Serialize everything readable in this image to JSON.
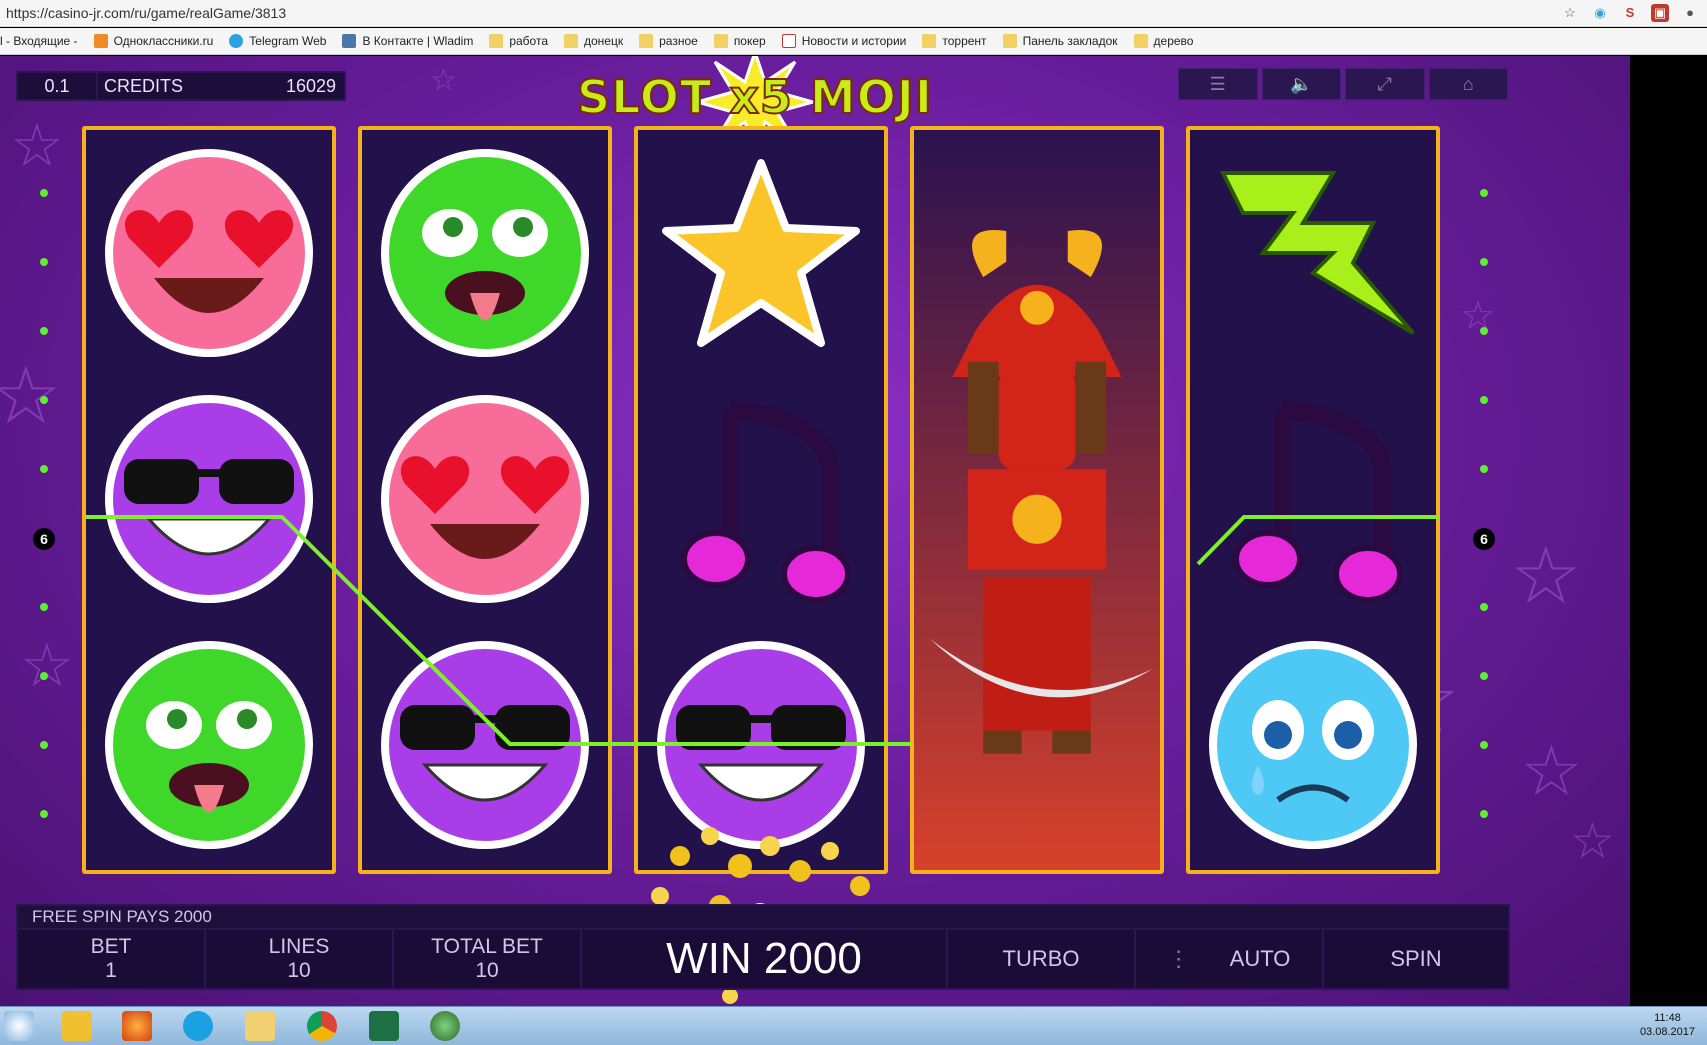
{
  "browser": {
    "url": "https://casino-jr.com/ru/game/realGame/3813",
    "bookmarks": [
      "l - Входящие - ",
      "Одноклассники.ru",
      "Telegram Web",
      "В Контакте | Wladim",
      "работа",
      "донецк",
      "разное",
      "покер",
      "Новости и истории",
      "торрент",
      "Панель закладок",
      "дерево"
    ]
  },
  "game": {
    "bet_display": "0.1",
    "credits_label": "CREDITS",
    "credits_value": "16029",
    "logo_text": "SLOT x5 MOJI",
    "menu_icons": [
      "menu-icon",
      "sound-icon",
      "fullscreen-icon",
      "home-icon"
    ],
    "line_number": "6",
    "reels": [
      [
        "heart-eyes",
        "cool-sunglasses",
        "sick-tongue"
      ],
      [
        "sick-tongue",
        "heart-eyes",
        "cool-sunglasses"
      ],
      [
        "star",
        "music-note",
        "cool-sunglasses"
      ],
      [
        "samurai",
        "samurai",
        "samurai"
      ],
      [
        "lightning",
        "music-note",
        "sad-crying"
      ]
    ],
    "free_spin_text": "FREE SPIN PAYS 2000",
    "controls": {
      "bet_label": "BET",
      "bet_value": "1",
      "lines_label": "LINES",
      "lines_value": "10",
      "total_bet_label": "TOTAL BET",
      "total_bet_value": "10",
      "win_text": "WIN 2000",
      "turbo_label": "TURBO",
      "auto_label": "AUTO",
      "spin_label": "SPIN"
    }
  },
  "taskbar": {
    "time": "11:48",
    "date": "03.08.2017"
  }
}
